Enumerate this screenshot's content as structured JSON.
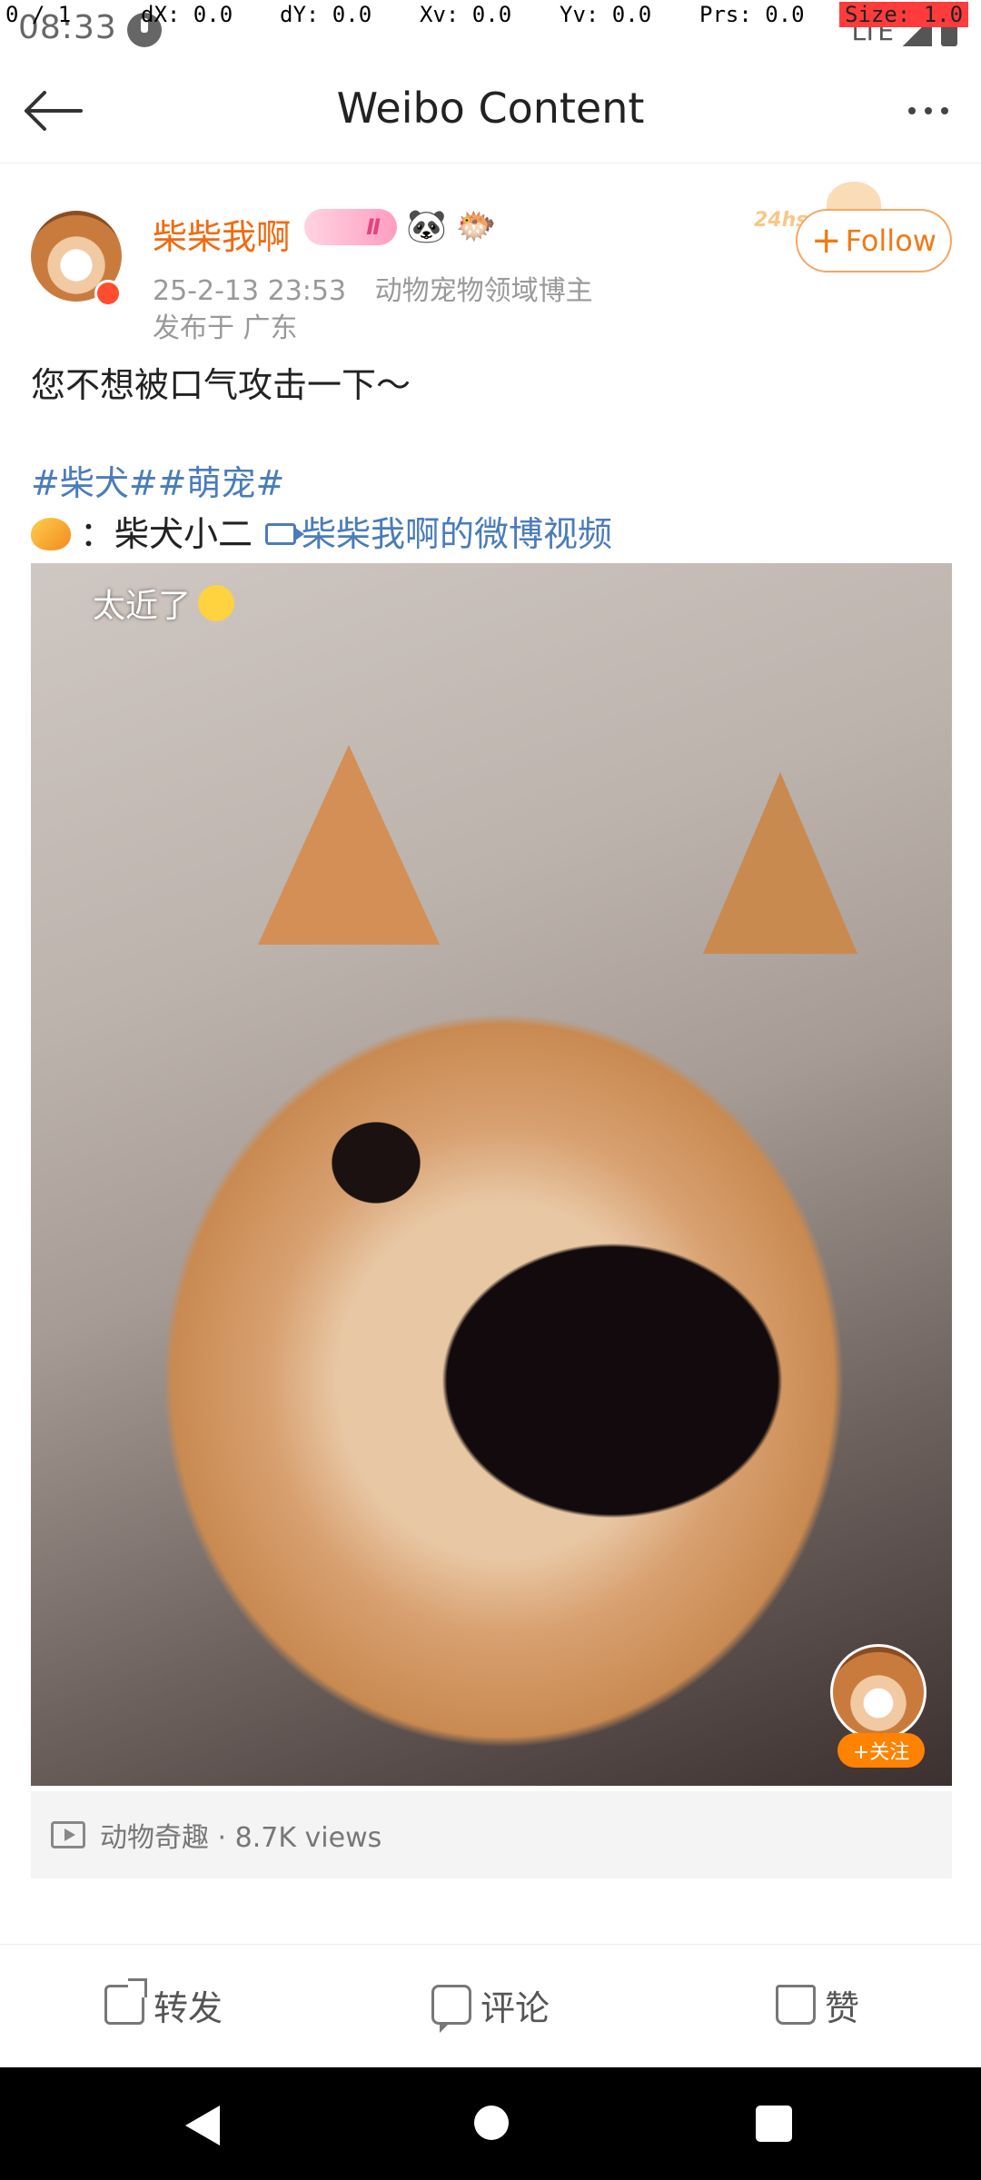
{
  "status_bar": {
    "time": "08:33",
    "network": "LTE"
  },
  "debug_overlay": {
    "pointer": "0 / 1",
    "dx": "dX: 0.0",
    "dy": "dY: 0.0",
    "xv": "Xv: 0.0",
    "yv": "Yv: 0.0",
    "prs": "Prs: 0.0",
    "size": "Size: 1.0"
  },
  "header": {
    "title": "Weibo Content"
  },
  "author": {
    "name": "柴柴我啊",
    "vip_level": "Ⅱ",
    "emoji_1": "🐼",
    "emoji_2": "🐡",
    "datetime": "25-2-13 23:53",
    "tagline": "动物宠物领域博主",
    "location": "发布于 广东",
    "deco_text": "24hs",
    "follow_label": "Follow",
    "follow_plus": "+"
  },
  "post": {
    "text": "您不想被口气攻击一下～",
    "tags": "#柴犬##萌宠#",
    "source_prefix": "：",
    "source_user": "柴犬小二",
    "video_link": "柴柴我啊的微博视频"
  },
  "video": {
    "caption": "太近了",
    "follow_label": "+关注"
  },
  "video_info": {
    "text": "动物奇趣 · 8.7K views"
  },
  "actions": {
    "repost": "转发",
    "comment": "评论",
    "like": "赞"
  },
  "colors": {
    "accent_orange": "#f07a15",
    "link_blue": "#4a7cba",
    "video_follow": "#ff8200"
  }
}
